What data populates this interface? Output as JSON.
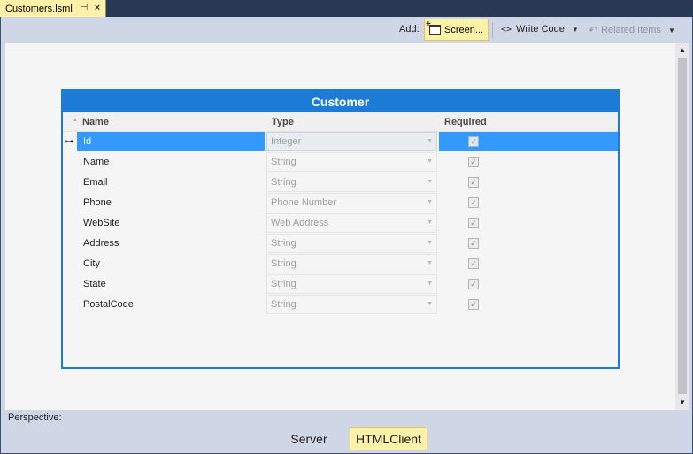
{
  "tab": {
    "title": "Customers.lsml",
    "pin_icon": "pin-icon",
    "close_icon": "close-icon"
  },
  "toolbar": {
    "add_label": "Add:",
    "screen_label": "Screen...",
    "write_code_label": "Write Code",
    "related_items_label": "Related Items"
  },
  "entity": {
    "title": "Customer",
    "columns": {
      "name": "Name",
      "type": "Type",
      "required": "Required"
    },
    "rows": [
      {
        "name": "Id",
        "type": "Integer",
        "required": true,
        "key": true,
        "selected": true
      },
      {
        "name": "Name",
        "type": "String",
        "required": true
      },
      {
        "name": "Email",
        "type": "String",
        "required": true
      },
      {
        "name": "Phone",
        "type": "Phone Number",
        "required": true
      },
      {
        "name": "WebSite",
        "type": "Web Address",
        "required": true
      },
      {
        "name": "Address",
        "type": "String",
        "required": true
      },
      {
        "name": "City",
        "type": "String",
        "required": true
      },
      {
        "name": "State",
        "type": "String",
        "required": true
      },
      {
        "name": "PostalCode",
        "type": "String",
        "required": true
      }
    ]
  },
  "perspective": {
    "label": "Perspective:",
    "options": [
      "Server",
      "HTMLClient"
    ],
    "selected": "HTMLClient"
  },
  "colors": {
    "accent": "#1c7cd5",
    "selection": "#3399ff",
    "highlight": "#fff1a8",
    "chrome": "#cfd6e5",
    "window": "#293955"
  }
}
